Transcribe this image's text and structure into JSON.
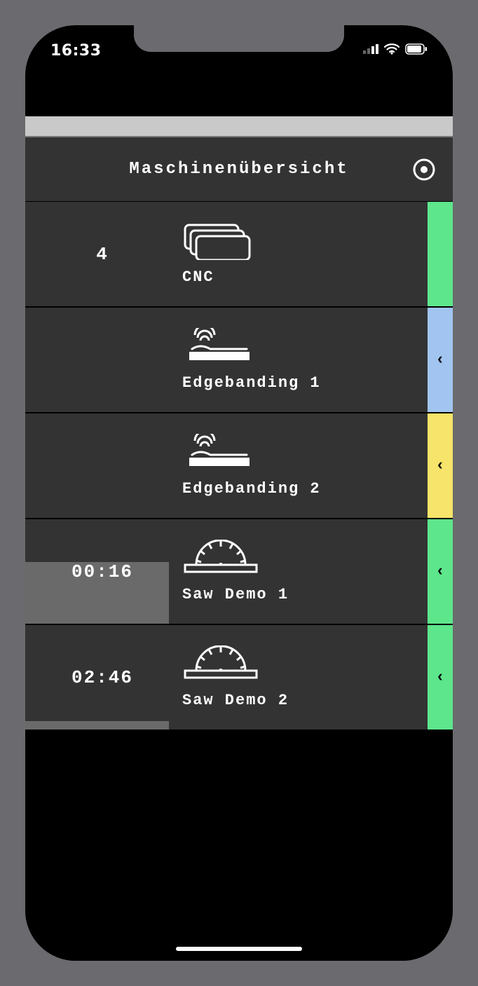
{
  "statusbar": {
    "time": "16:33"
  },
  "header": {
    "title": "Maschinenübersicht"
  },
  "colors": {
    "green": "#5ee68c",
    "blue": "#a1c5f0",
    "yellow": "#f7e46a"
  },
  "machines": [
    {
      "left_text": "4",
      "name": "CNC",
      "tab_color": "green",
      "has_chevron": false,
      "icon": "stack"
    },
    {
      "left_text": "",
      "name": "Edgebanding 1",
      "tab_color": "blue",
      "has_chevron": true,
      "icon": "edgeband"
    },
    {
      "left_text": "",
      "name": "Edgebanding 2",
      "tab_color": "yellow",
      "has_chevron": true,
      "icon": "edgeband"
    },
    {
      "left_text": "00:16",
      "name": "Saw Demo 1",
      "tab_color": "green",
      "has_chevron": true,
      "icon": "saw"
    },
    {
      "left_text": "02:46",
      "name": "Saw Demo 2",
      "tab_color": "green",
      "has_chevron": true,
      "icon": "saw"
    }
  ]
}
